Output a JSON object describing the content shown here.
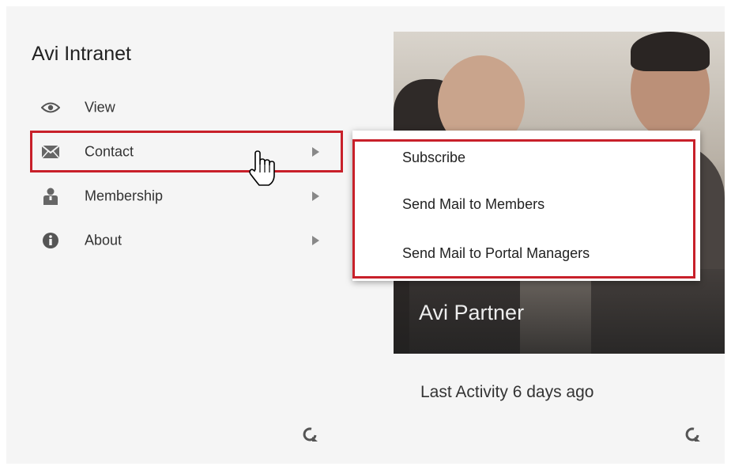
{
  "site": {
    "title": "Avi Intranet"
  },
  "menu": {
    "items": [
      {
        "label": "View",
        "icon": "eye-icon",
        "has_submenu": false
      },
      {
        "label": "Contact",
        "icon": "envelope-icon",
        "has_submenu": true,
        "active": true
      },
      {
        "label": "Membership",
        "icon": "person-icon",
        "has_submenu": true
      },
      {
        "label": "About",
        "icon": "info-icon",
        "has_submenu": true
      }
    ]
  },
  "submenu": {
    "items": [
      {
        "label": "Subscribe"
      },
      {
        "label": "Send Mail to Members"
      },
      {
        "label": "Send Mail to Portal Managers"
      }
    ]
  },
  "hero": {
    "label": "Avi Partner"
  },
  "activity": {
    "text": "Last Activity 6 days ago"
  },
  "colors": {
    "highlight": "#c8202a",
    "panel": "#f5f5f5"
  }
}
